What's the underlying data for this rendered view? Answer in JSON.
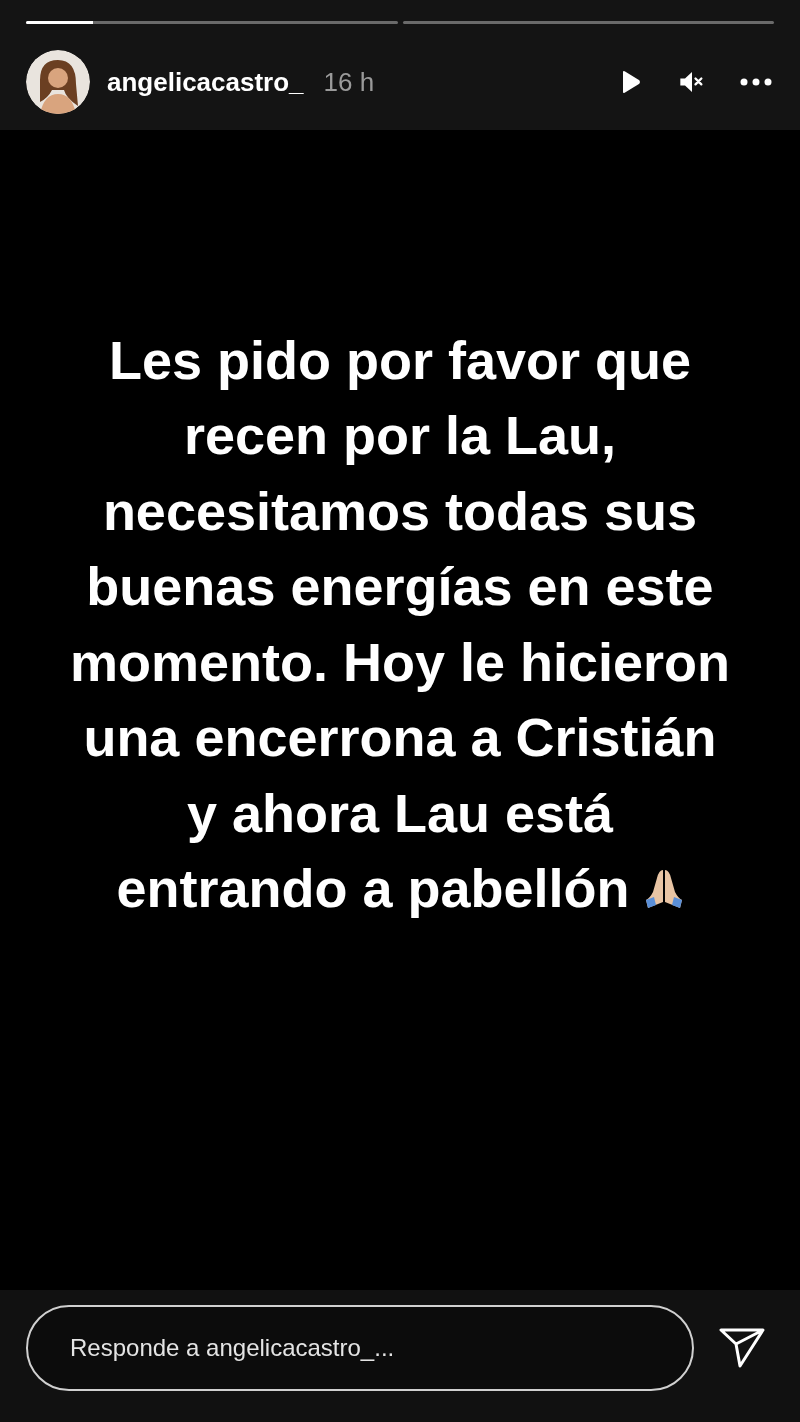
{
  "progress": [
    {
      "level": 0.18
    }
  ],
  "header": {
    "username": "angelicacastro_",
    "time": "16 h"
  },
  "story": {
    "lines": [
      "Les pido por favor que",
      "recen por la Lau,",
      "necesitamos todas sus",
      "buenas energías en este",
      "momento. Hoy le hicieron",
      "una encerrona a Cristián",
      "y ahora Lau está",
      "entrando a pabellón"
    ]
  },
  "reply": {
    "placeholder": "Responde a angelicacastro_..."
  }
}
